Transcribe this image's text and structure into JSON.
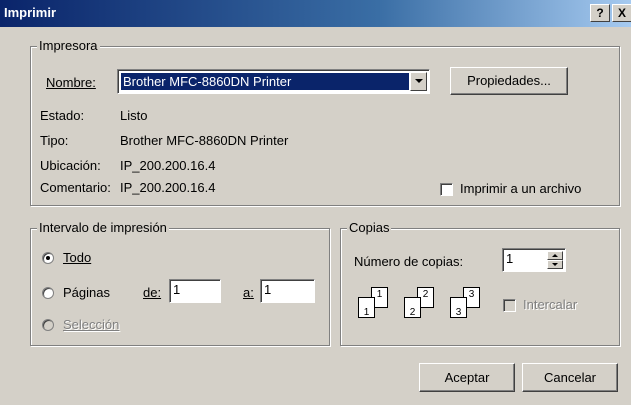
{
  "window": {
    "title": "Imprimir",
    "help_label": "?",
    "close_label": "X"
  },
  "printer_group": {
    "legend": "Impresora",
    "name_label": "Nombre:",
    "name_value": "Brother MFC-8860DN Printer",
    "properties_label": "Propiedades...",
    "status_label": "Estado:",
    "status_value": "Listo",
    "type_label": "Tipo:",
    "type_value": "Brother MFC-8860DN Printer",
    "location_label": "Ubicación:",
    "location_value": "IP_200.200.16.4",
    "comment_label": "Comentario:",
    "comment_value": "IP_200.200.16.4",
    "print_to_file_label": "Imprimir a un archivo",
    "print_to_file_checked": false
  },
  "range_group": {
    "legend": "Intervalo de impresión",
    "all_label": "Todo",
    "all_selected": true,
    "pages_label": "Páginas",
    "from_label": "de:",
    "from_value": "1",
    "to_label": "a:",
    "to_value": "1",
    "selection_label": "Selección"
  },
  "copies_group": {
    "legend": "Copias",
    "num_copies_label": "Número de copias:",
    "num_copies_value": "1",
    "collate_label": "Intercalar",
    "collate_icons": [
      {
        "back": "1",
        "front": "1"
      },
      {
        "back": "2",
        "front": "2"
      },
      {
        "back": "3",
        "front": "3"
      }
    ]
  },
  "buttons": {
    "ok_label": "Aceptar",
    "cancel_label": "Cancelar"
  },
  "colors": {
    "titlebar_start": "#0a246a",
    "titlebar_end": "#a6caf0",
    "dialog_bg": "#d4d0c8",
    "selection": "#0a246a"
  }
}
